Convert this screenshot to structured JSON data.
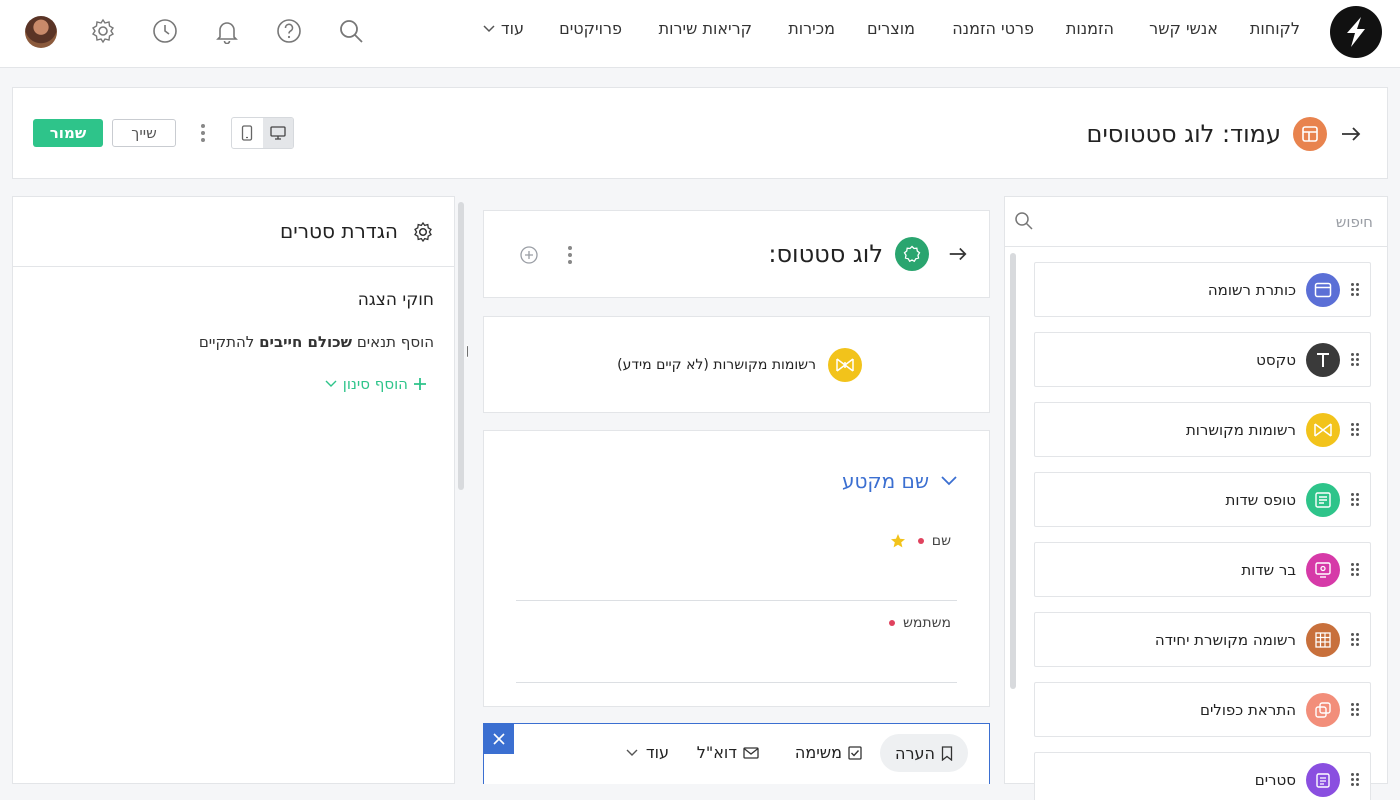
{
  "nav": {
    "items": [
      "לקוחות",
      "אנשי קשר",
      "הזמנות",
      "פרטי הזמנה",
      "מוצרים",
      "מכירות",
      "קריאות שירות",
      "פרויקטים"
    ],
    "more_label": "עוד"
  },
  "header": {
    "title": "עמוד: לוג סטטוסים",
    "save_label": "שמור",
    "share_label": "שייך"
  },
  "row_panel": {
    "title": "הגדרת סטרים",
    "rules_title": "חוקי הצגה",
    "rules_desc_prefix": "הוסף תנאים",
    "rules_desc_bold": "שכולם חייבים",
    "rules_desc_suffix": "להתקיים",
    "add_filter_label": "הוסף סינון"
  },
  "canvas": {
    "record_title": "לוג סטטוס:",
    "related_records_label": "רשומות מקושרות (לא קיים מידע)",
    "section_name": "שם מקטע",
    "fields": [
      {
        "label": "שם"
      },
      {
        "label": "משתמש"
      }
    ],
    "bottom_tabs": {
      "note": "הערה",
      "task": "משימה",
      "email": "דוא\"ל",
      "more": "עוד"
    }
  },
  "components": {
    "search_placeholder": "חיפוש",
    "items": [
      {
        "label": "כותרת רשומה",
        "color": "#5b6fd6",
        "icon": "header-icon"
      },
      {
        "label": "טקסט",
        "color": "#3a3a3a",
        "icon": "text-icon"
      },
      {
        "label": "רשומות מקושרות",
        "color": "#f2c31b",
        "icon": "related-records-icon"
      },
      {
        "label": "טופס שדות",
        "color": "#2ec48a",
        "icon": "form-icon"
      },
      {
        "label": "בר שדות",
        "color": "#d63aa8",
        "icon": "field-bar-icon"
      },
      {
        "label": "רשומה מקושרת יחידה",
        "color": "#c8703c",
        "icon": "table-icon"
      },
      {
        "label": "התראת כפולים",
        "color": "#f28e7a",
        "icon": "duplicates-icon"
      },
      {
        "label": "סטרים",
        "color": "#8a4fe0",
        "icon": "stream-icon"
      }
    ]
  },
  "colors": {
    "accent_green": "#2ec48a",
    "section_blue": "#3b6fd1",
    "required_red": "#e0425e"
  }
}
